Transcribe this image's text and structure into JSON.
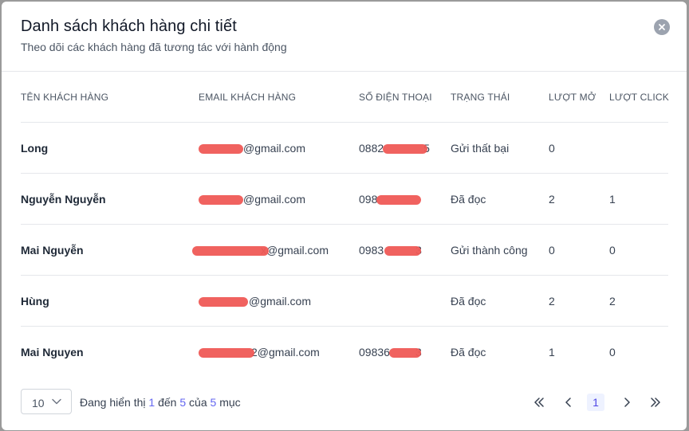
{
  "modal": {
    "title": "Danh sách khách hàng chi tiết",
    "subtitle": "Theo dõi các khách hàng đã tương tác với hành động",
    "close_icon": "close-icon"
  },
  "table": {
    "headers": [
      "TÊN KHÁCH HÀNG",
      "EMAIL KHÁCH HÀNG",
      "SỐ ĐIỆN THOẠI",
      "TRẠNG THÁI",
      "LƯỢT MỞ",
      "LƯỢT CLICK"
    ],
    "rows": [
      {
        "name": "Long",
        "email": "@gmail.com",
        "phone_prefix": "0882",
        "phone_suffix": "5",
        "status": "Gửi thất bại",
        "opens": "0",
        "clicks": ""
      },
      {
        "name": "Nguyễn Nguyễn",
        "email": "@gmail.com",
        "phone_prefix": "098",
        "phone_suffix": "",
        "status": "Đã đọc",
        "opens": "2",
        "clicks": "1"
      },
      {
        "name": "Mai Nguyễn",
        "email": "x@gmail.com",
        "phone_prefix": "0983",
        "phone_suffix": "3",
        "status": "Gửi thành công",
        "opens": "0",
        "clicks": "0"
      },
      {
        "name": "Hùng",
        "email": "@gmail.com",
        "phone_prefix": "",
        "phone_suffix": "",
        "status": "Đã đọc",
        "opens": "2",
        "clicks": "2"
      },
      {
        "name": "Mai Nguyen",
        "email": "2@gmail.com",
        "phone_prefix": "09836",
        "phone_suffix": "3",
        "status": "Đã đọc",
        "opens": "1",
        "clicks": "0"
      }
    ]
  },
  "footer": {
    "page_size": "10",
    "showing_prefix": "Đang hiển thị",
    "from": "1",
    "to_word": "đến",
    "to": "5",
    "of_word": "của",
    "total": "5",
    "unit": "mục",
    "current_page": "1"
  },
  "colors": {
    "accent": "#6366f1",
    "redaction": "#ef5a56"
  }
}
